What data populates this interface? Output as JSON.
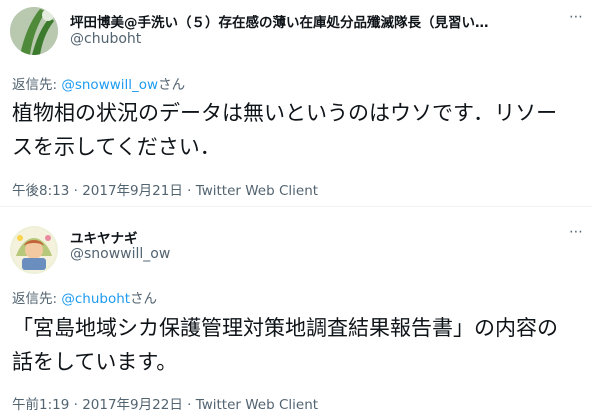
{
  "tweets": [
    {
      "display_name": "坪田博美@手洗い（５）存在感の薄い在庫処分品殲滅隊長（見習い…",
      "handle": "@chuboht",
      "more_icon": "⋯",
      "reply_label": "返信先: ",
      "reply_mention": "@snowwill_ow",
      "reply_suffix": "さん",
      "text": "植物相の状況のデータは無いというのはウソです．リソースを示してください．",
      "time": "午後8:13",
      "date": "2017年9月21日",
      "client": "Twitter Web Client",
      "sep": " · "
    },
    {
      "display_name": "ユキヤナギ",
      "handle": "@snowwill_ow",
      "more_icon": "⋯",
      "reply_label": "返信先: ",
      "reply_mention": "@chuboht",
      "reply_suffix": "さん",
      "text": "「宮島地域シカ保護管理対策地調査結果報告書」の内容の話をしています。",
      "time": "午前1:19",
      "date": "2017年9月22日",
      "client": "Twitter Web Client",
      "sep": " · "
    }
  ]
}
